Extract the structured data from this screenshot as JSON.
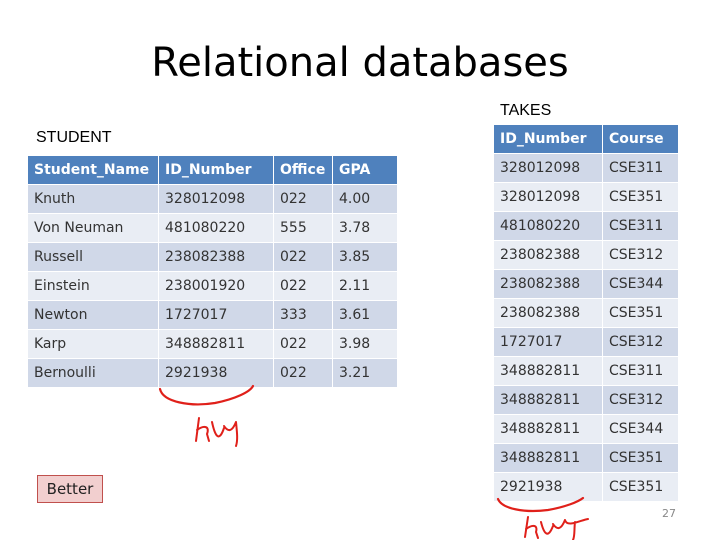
{
  "slide": {
    "title": "Relational databases",
    "page_number": "27"
  },
  "student": {
    "caption": "STUDENT",
    "headers": [
      "Student_Name",
      "ID_Number",
      "Office",
      "GPA"
    ],
    "rows": [
      [
        "Knuth",
        "328012098",
        "022",
        "4.00"
      ],
      [
        "Von Neuman",
        "481080220",
        "555",
        "3.78"
      ],
      [
        "Russell",
        "238082388",
        "022",
        "3.85"
      ],
      [
        "Einstein",
        "238001920",
        "022",
        "2.11"
      ],
      [
        "Newton",
        "1727017",
        "333",
        "3.61"
      ],
      [
        "Karp",
        "348882811",
        "022",
        "3.98"
      ],
      [
        "Bernoulli",
        "2921938",
        "022",
        "3.21"
      ]
    ]
  },
  "takes": {
    "caption": "TAKES",
    "headers": [
      "ID_Number",
      "Course"
    ],
    "rows": [
      [
        "328012098",
        "CSE311"
      ],
      [
        "328012098",
        "CSE351"
      ],
      [
        "481080220",
        "CSE311"
      ],
      [
        "238082388",
        "CSE312"
      ],
      [
        "238082388",
        "CSE344"
      ],
      [
        "238082388",
        "CSE351"
      ],
      [
        "1727017",
        "CSE312"
      ],
      [
        "348882811",
        "CSE311"
      ],
      [
        "348882811",
        "CSE312"
      ],
      [
        "348882811",
        "CSE344"
      ],
      [
        "348882811",
        "CSE351"
      ],
      [
        "2921938",
        "CSE351"
      ]
    ]
  },
  "button": {
    "label": "Better"
  },
  "colors": {
    "header_bg": "#4f81bd",
    "row_odd": "#d0d8e8",
    "row_even": "#e9edf4",
    "ink": "#e0201a",
    "button_bg": "#f2cfcf"
  }
}
